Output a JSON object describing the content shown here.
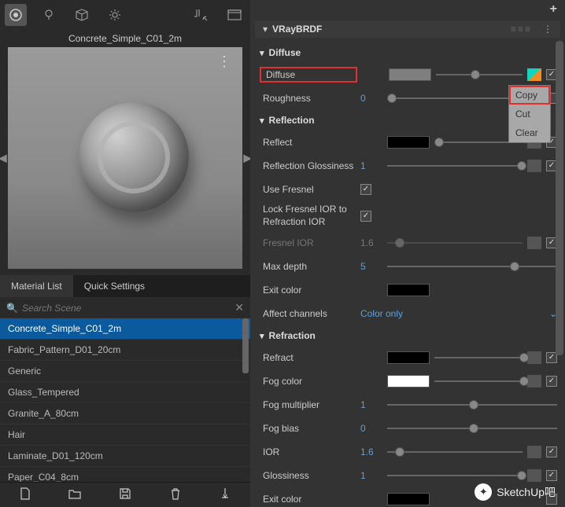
{
  "preview": {
    "title": "Concrete_Simple_C01_2m"
  },
  "tabs": {
    "list": "Material List",
    "quick": "Quick Settings"
  },
  "search": {
    "placeholder": "Search Scene"
  },
  "materials": [
    "Concrete_Simple_C01_2m",
    "Fabric_Pattern_D01_20cm",
    "Generic",
    "Glass_Tempered",
    "Granite_A_80cm",
    "Hair",
    "Laminate_D01_120cm",
    "Paper_C04_8cm"
  ],
  "brdf": {
    "title": "VRayBRDF"
  },
  "sections": {
    "diffuse": {
      "title": "Diffuse",
      "diffuse_label": "Diffuse",
      "roughness_label": "Roughness",
      "roughness_value": "0",
      "diffuse_color": "#7f7f7f"
    },
    "reflection": {
      "title": "Reflection",
      "reflect_label": "Reflect",
      "reflect_color": "#000000",
      "gloss_label": "Reflection Glossiness",
      "gloss_value": "1",
      "fresnel_label": "Use Fresnel",
      "lockior_label": "Lock Fresnel IOR to Refraction IOR",
      "fresnelior_label": "Fresnel IOR",
      "fresnelior_value": "1.6",
      "maxdepth_label": "Max depth",
      "maxdepth_value": "5",
      "exit_label": "Exit color",
      "exit_color": "#000000",
      "affect_label": "Affect channels",
      "affect_value": "Color only"
    },
    "refraction": {
      "title": "Refraction",
      "refract_label": "Refract",
      "refract_color": "#000000",
      "fog_label": "Fog color",
      "fog_color": "#ffffff",
      "fogmult_label": "Fog multiplier",
      "fogmult_value": "1",
      "fogbias_label": "Fog bias",
      "fogbias_value": "0",
      "ior_label": "IOR",
      "ior_value": "1.6",
      "gloss_label": "Glossiness",
      "gloss_value": "1",
      "exit_label": "Exit color",
      "exit_color": "#000000"
    }
  },
  "context_menu": {
    "copy": "Copy",
    "cut": "Cut",
    "clear": "Clear"
  },
  "watermark": {
    "text": "SketchUp吧"
  }
}
